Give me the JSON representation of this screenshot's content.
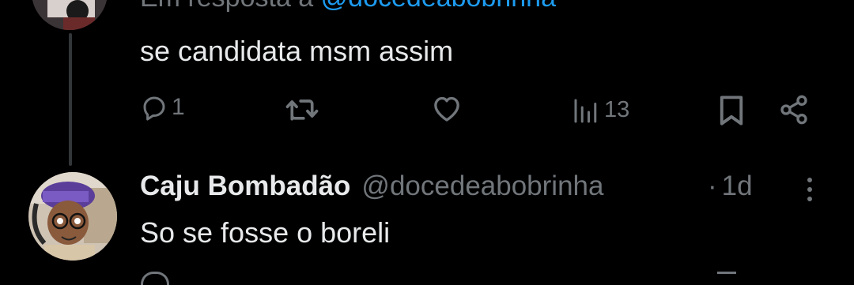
{
  "reply_tweet": {
    "replying_to_prefix": "Em resposta a",
    "replying_to_handle": "@docedeabobrinha",
    "text": "se candidata msm assim",
    "actions": {
      "replies": "1",
      "retweets": "",
      "likes": "",
      "views": "13"
    }
  },
  "next_tweet": {
    "display_name": "Caju Bombadão",
    "handle": "@docedeabobrinha",
    "separator": "·",
    "time": "1d",
    "text": "So se fosse o boreli"
  },
  "colors": {
    "background": "#000000",
    "text_primary": "#e7e9ea",
    "text_secondary": "#71767b",
    "link": "#1d9bf0",
    "thread_line": "#333639"
  }
}
